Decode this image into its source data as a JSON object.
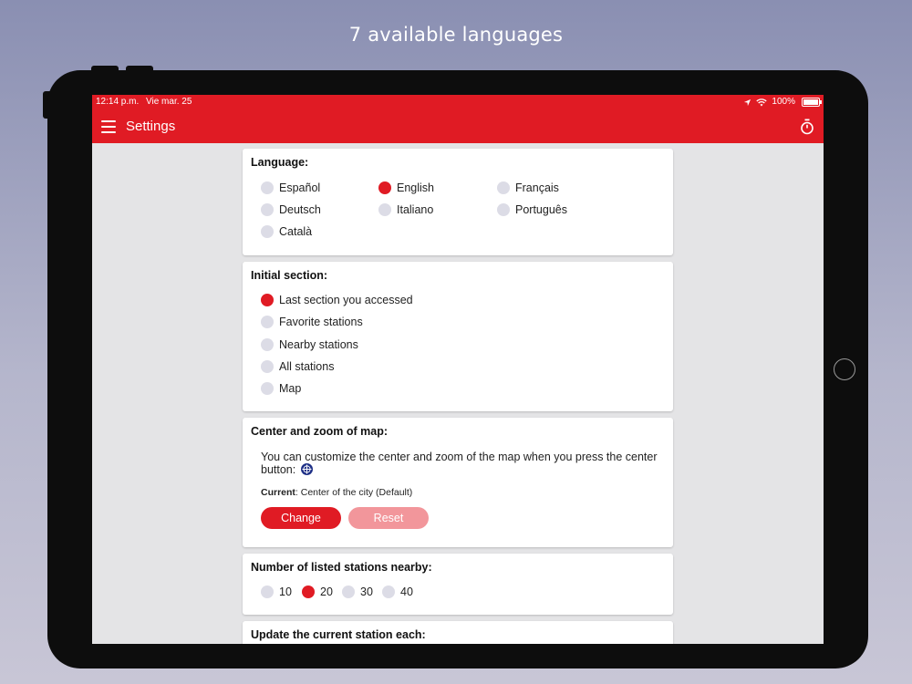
{
  "caption": "7 available languages",
  "status_bar": {
    "time": "12:14 p.m.",
    "date": "Vie mar. 25",
    "battery": "100%"
  },
  "app_bar": {
    "title": "Settings",
    "menu_icon": "hamburger-menu-icon",
    "timer_icon": "stopwatch-icon"
  },
  "colors": {
    "accent": "#e01b24",
    "radio_off": "#dcdce6",
    "crosshair": "#1d2f86",
    "reset_button": "#f2969b"
  },
  "language": {
    "heading": "Language:",
    "selected": "English",
    "options": [
      "Español",
      "English",
      "Français",
      "Deutsch",
      "Italiano",
      "Português",
      "Català"
    ]
  },
  "initial_section": {
    "heading": "Initial section:",
    "selected": "Last section you accessed",
    "options": [
      "Last section you accessed",
      "Favorite stations",
      "Nearby stations",
      "All stations",
      "Map"
    ]
  },
  "map_center": {
    "heading": "Center and zoom of map:",
    "description": "You can customize the center and zoom of the map when you press the center button:",
    "current_label": "Current",
    "current_value": ": Center of the city (Default)",
    "change_label": "Change",
    "reset_label": "Reset"
  },
  "nearby_count": {
    "heading": "Number of listed stations nearby:",
    "selected": "20",
    "options": [
      "10",
      "20",
      "30",
      "40"
    ]
  },
  "update_station": {
    "heading": "Update the current station each:"
  }
}
